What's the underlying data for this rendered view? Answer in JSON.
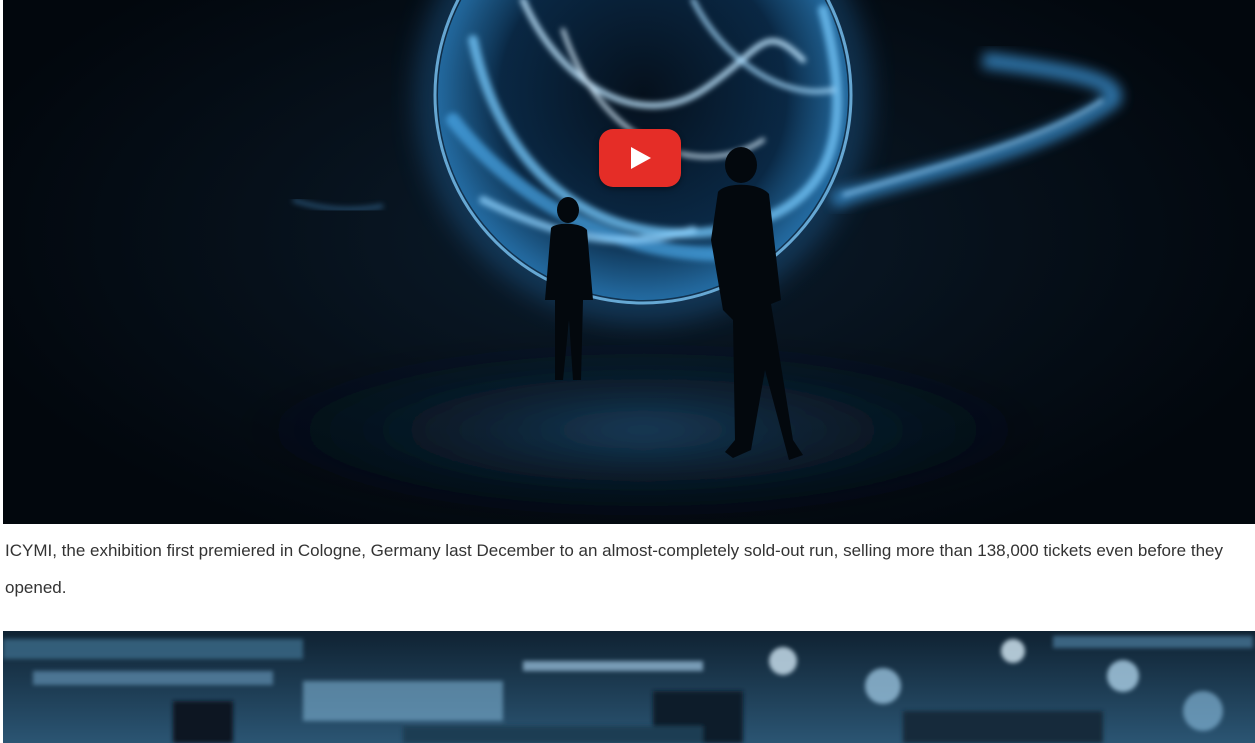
{
  "video": {
    "play_label": "Play video",
    "colors": {
      "glow": "#4aa8e8",
      "glow_light": "#bfe6ff",
      "background": "#06101a",
      "play_button": "#e52d27"
    }
  },
  "article": {
    "caption": "ICYMI, the exhibition first premiered in Cologne, Germany last December to an almost-completely sold-out run, selling more than 138,000 tickets even before they opened."
  },
  "image2": {
    "colors": {
      "base": "#1b3446",
      "highlight": "#cfe6f4"
    }
  }
}
